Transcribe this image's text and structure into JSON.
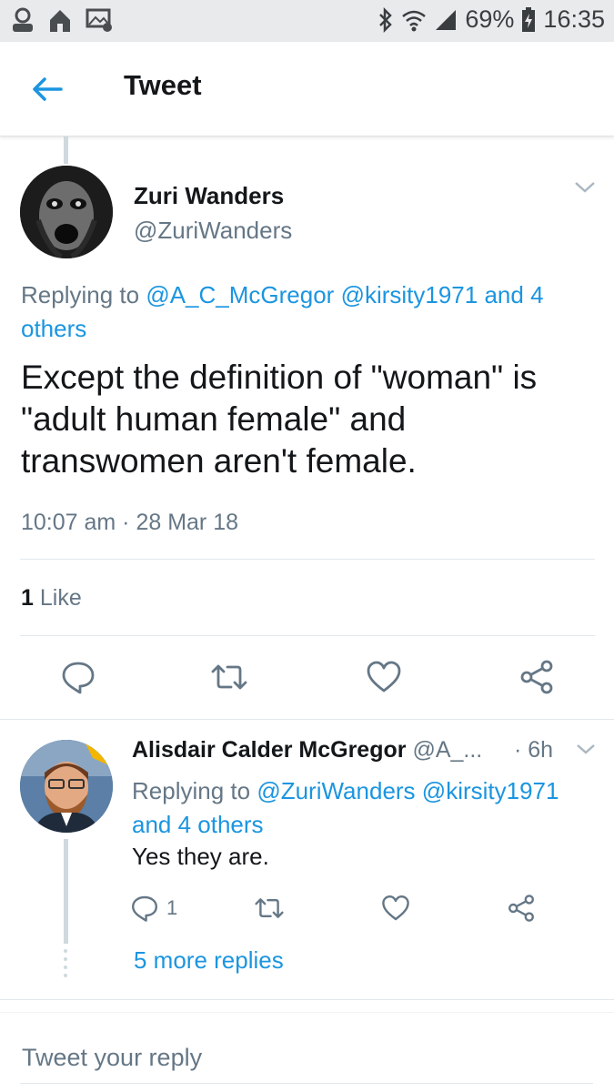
{
  "status_bar": {
    "battery": "69%",
    "time": "16:35"
  },
  "header": {
    "title": "Tweet"
  },
  "main_tweet": {
    "name": "Zuri Wanders",
    "handle": "@ZuriWanders",
    "replying_prefix": "Replying to",
    "replying_mention_1": "@A_C_McGregor",
    "replying_mention_2": "@kirsity1971",
    "replying_others": "and 4 others",
    "text": "Except the definition of \"woman\" is \"adult human female\" and transwomen aren't female.",
    "timestamp": "10:07 am · 28 Mar 18",
    "like_count": "1",
    "like_label": "Like"
  },
  "reply_tweet": {
    "name": "Alisdair Calder McGregor",
    "handle": "@A_...",
    "time": "· 6h",
    "replying_prefix": "Replying to",
    "replying_mention_1": "@ZuriWanders",
    "replying_mention_2": "@kirsity1971",
    "replying_others": "and 4 others",
    "text": "Yes they are.",
    "reply_count": "1",
    "more_replies": "5 more replies"
  },
  "compose": {
    "placeholder": "Tweet your reply"
  },
  "colors": {
    "accent": "#1b95e0",
    "secondary_text": "#657786",
    "status_bar_bg": "#e9eaec"
  }
}
